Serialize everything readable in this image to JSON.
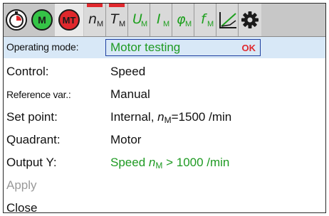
{
  "toolbar": {
    "left_buttons": [
      {
        "icon": "stopwatch-icon",
        "label": "",
        "color": "#e0282d"
      },
      {
        "icon": "motor-manual-icon",
        "label": "M",
        "color": "#35c447"
      },
      {
        "icon": "motor-testing-icon",
        "label": "MT",
        "color": "#e0282d"
      }
    ],
    "quantities": [
      {
        "symbol": "n",
        "sub": "M",
        "active": true
      },
      {
        "symbol": "T",
        "sub": "M",
        "active": true
      },
      {
        "symbol": "U",
        "sub": "M",
        "active": false
      },
      {
        "symbol": "I",
        "sub": "M",
        "active": false
      },
      {
        "symbol": "φ",
        "sub": "M",
        "active": false
      },
      {
        "symbol": "f",
        "sub": "M",
        "active": false
      }
    ],
    "right_icons": [
      "chart-icon",
      "gear-icon"
    ]
  },
  "menu": {
    "operating_mode": {
      "label": "Operating mode:",
      "value": "Motor testing",
      "status": "OK"
    },
    "control": {
      "label": "Control:",
      "value": "Speed"
    },
    "reference": {
      "label": "Reference var.:",
      "value": "Manual"
    },
    "setpoint": {
      "label": "Set point:",
      "value_prefix": "Internal, ",
      "sym": "n",
      "sub": "M",
      "value_suffix": "=1500 /min"
    },
    "quadrant": {
      "label": "Quadrant:",
      "value": "Motor"
    },
    "output": {
      "label": "Output Y:",
      "value_prefix": "Speed ",
      "sym": "n",
      "sub": "M",
      "value_suffix": " > 1000 /min"
    },
    "apply": {
      "label": "Apply"
    },
    "close": {
      "label": "Close"
    }
  },
  "colors": {
    "accent_green": "#1e9a22",
    "active_red": "#e0282d",
    "highlight": "#d8e8f7"
  }
}
